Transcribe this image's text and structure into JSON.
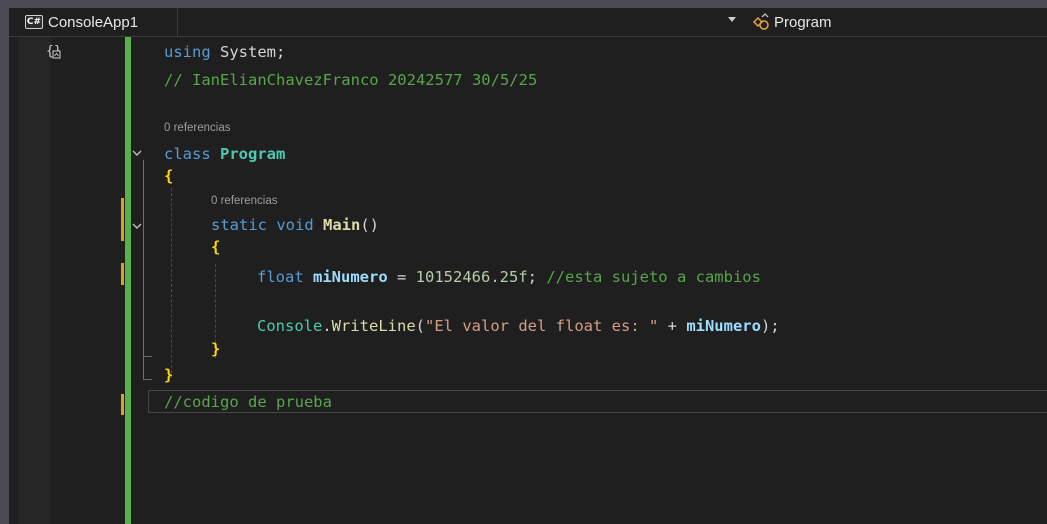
{
  "navbar": {
    "project_badge": "C#",
    "project_name": "ConsoleApp1",
    "member_name": "Program"
  },
  "code_lens": {
    "class_refs": "0 referencias",
    "method_refs": "0 referencias"
  },
  "code": {
    "line1": {
      "kw": "using",
      "rest": " System;"
    },
    "line2": "// IanElianChavezFranco 20242577 30/5/25",
    "line3": {
      "kw": "class",
      "name": " Program"
    },
    "line4": "{",
    "line5": {
      "kw1": "static",
      "kw2": " void",
      "name": " Main",
      "parens": "()"
    },
    "line6": "{",
    "line7": {
      "type": "float",
      "var": " miNumero",
      "op": " = ",
      "num": "10152466.25f",
      "semi": "; ",
      "comment": "//esta sujeto a cambios"
    },
    "line8": {
      "cls": "Console",
      "dot": ".",
      "mth": "WriteLine",
      "open": "(",
      "str": "\"El valor del float es: \"",
      "plus": " + ",
      "var": "miNumero",
      "close": ");"
    },
    "line9": "}",
    "line10": "}",
    "line11": "//codigo de prueba"
  }
}
